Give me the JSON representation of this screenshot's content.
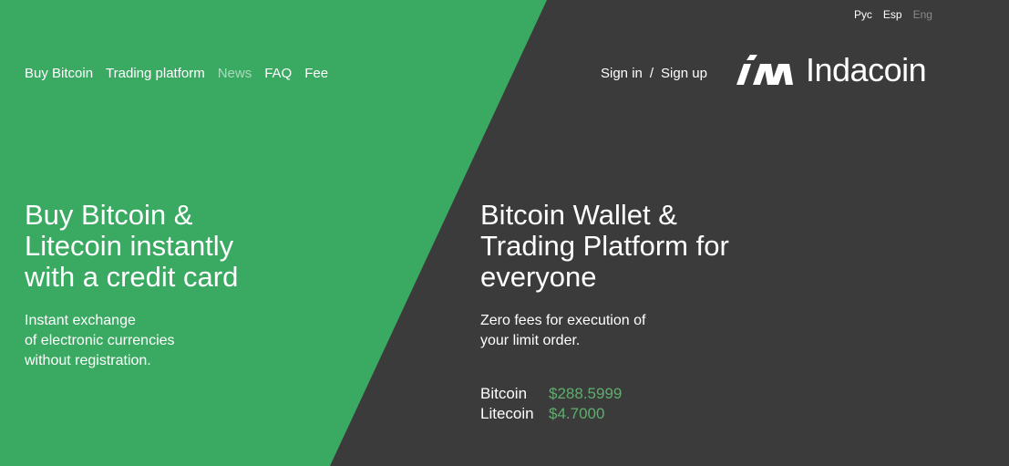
{
  "languages": [
    {
      "label": "Рус",
      "active": false
    },
    {
      "label": "Esp",
      "active": false
    },
    {
      "label": "Eng",
      "active": true
    }
  ],
  "nav": {
    "items": [
      "Buy Bitcoin",
      "Trading platform",
      "News",
      "FAQ",
      "Fee"
    ]
  },
  "auth": {
    "sign_in": "Sign in",
    "separator": "/",
    "sign_up": "Sign up"
  },
  "logo": {
    "text": "Indacoin",
    "icon": "indacoin-logo-icon"
  },
  "hero_left": {
    "headline": "Buy Bitcoin &\nLitecoin instantly\nwith a credit card",
    "subtext": "Instant exchange\nof electronic currencies\nwithout registration."
  },
  "hero_right": {
    "headline": "Bitcoin Wallet &\nTrading Platform for\neveryone",
    "subtext": "Zero fees for execution of\nyour limit order."
  },
  "rates": [
    {
      "name": "Bitcoin",
      "price": "$288.5999"
    },
    {
      "name": "Litecoin",
      "price": "$4.7000"
    }
  ],
  "colors": {
    "green_panel": "#3aaa62",
    "dark_panel": "#3b3b3b",
    "price": "#5fae6e"
  }
}
